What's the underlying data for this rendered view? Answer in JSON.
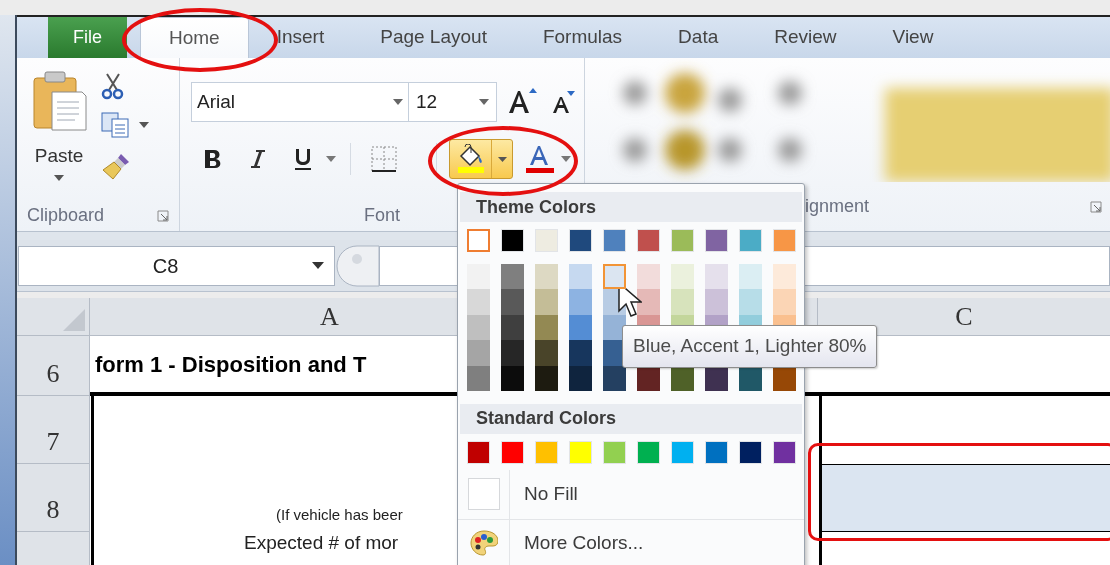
{
  "ribbon": {
    "tabs": [
      {
        "label": "File",
        "kind": "file",
        "selected": false,
        "circled": false
      },
      {
        "label": "Home",
        "kind": "tab",
        "selected": true,
        "circled": true
      },
      {
        "label": "Insert",
        "kind": "tab",
        "selected": false,
        "circled": false
      },
      {
        "label": "Page Layout",
        "kind": "tab",
        "selected": false,
        "circled": false
      },
      {
        "label": "Formulas",
        "kind": "tab",
        "selected": false,
        "circled": false
      },
      {
        "label": "Data",
        "kind": "tab",
        "selected": false,
        "circled": false
      },
      {
        "label": "Review",
        "kind": "tab",
        "selected": false,
        "circled": false
      },
      {
        "label": "View",
        "kind": "tab",
        "selected": false,
        "circled": false
      }
    ],
    "clipboard": {
      "paste_label": "Paste",
      "group_label": "Clipboard"
    },
    "font": {
      "font_name": "Arial",
      "font_size": "12",
      "group_label": "Font",
      "fill_button": {
        "circled": true,
        "pressed": true
      }
    },
    "alignment": {
      "group_label": "ignment"
    }
  },
  "formula_bar": {
    "name_box": "C8"
  },
  "sheet": {
    "columns": [
      {
        "label": "A"
      },
      {
        "label": "C"
      }
    ],
    "rows": [
      {
        "number": "6",
        "a": {
          "text": "form 1 - Disposition and T",
          "kind": "title"
        }
      },
      {
        "number": "7"
      },
      {
        "number": "8",
        "a": {
          "text": "(If vehicle has beer",
          "kind": "note"
        },
        "c": {
          "highlighted": true,
          "circled": true
        }
      },
      {
        "a": {
          "text": "Expected # of mor",
          "kind": "body"
        }
      }
    ]
  },
  "fill_menu": {
    "theme_header": "Theme Colors",
    "theme_columns": [
      {
        "color": "#ffffff",
        "selected": true,
        "shades": [
          {
            "color": "#f2f2f2",
            "hovered": false
          },
          {
            "color": "#d8d8d8",
            "hovered": false
          },
          {
            "color": "#bfbfbf",
            "hovered": false
          },
          {
            "color": "#a5a5a5",
            "hovered": false
          },
          {
            "color": "#7f7f7f",
            "hovered": false
          }
        ]
      },
      {
        "color": "#000000",
        "selected": false,
        "shades": [
          {
            "color": "#7f7f7f",
            "hovered": false
          },
          {
            "color": "#595959",
            "hovered": false
          },
          {
            "color": "#3f3f3f",
            "hovered": false
          },
          {
            "color": "#262626",
            "hovered": false
          },
          {
            "color": "#0c0c0c",
            "hovered": false
          }
        ]
      },
      {
        "color": "#eeece1",
        "selected": false,
        "shades": [
          {
            "color": "#ddd9c3",
            "hovered": false
          },
          {
            "color": "#c4bd97",
            "hovered": false
          },
          {
            "color": "#938953",
            "hovered": false
          },
          {
            "color": "#494429",
            "hovered": false
          },
          {
            "color": "#1d1b10",
            "hovered": false
          }
        ]
      },
      {
        "color": "#1f497d",
        "selected": false,
        "shades": [
          {
            "color": "#c6d9f0",
            "hovered": false
          },
          {
            "color": "#8db3e2",
            "hovered": false
          },
          {
            "color": "#548dd4",
            "hovered": false
          },
          {
            "color": "#17365d",
            "hovered": false
          },
          {
            "color": "#0f243e",
            "hovered": false
          }
        ]
      },
      {
        "color": "#4f81bd",
        "selected": false,
        "shades": [
          {
            "color": "#dbe5f1",
            "hovered": true
          },
          {
            "color": "#b8cce4",
            "hovered": false
          },
          {
            "color": "#95b3d7",
            "hovered": false
          },
          {
            "color": "#366092",
            "hovered": false
          },
          {
            "color": "#244061",
            "hovered": false
          }
        ]
      },
      {
        "color": "#c0504d",
        "selected": false,
        "shades": [
          {
            "color": "#f2dcdb",
            "hovered": false
          },
          {
            "color": "#e5b9b7",
            "hovered": false
          },
          {
            "color": "#d99694",
            "hovered": false
          },
          {
            "color": "#632423",
            "hovered": false
          }
        ]
      },
      {
        "color": "#9bbb59",
        "selected": false,
        "shades": [
          {
            "color": "#ebf1dd",
            "hovered": false
          },
          {
            "color": "#d7e3bc",
            "hovered": false
          },
          {
            "color": "#c3d69b",
            "hovered": false
          },
          {
            "color": "#4f6128",
            "hovered": false
          }
        ]
      },
      {
        "color": "#8064a2",
        "selected": false,
        "shades": [
          {
            "color": "#e5e0ec",
            "hovered": false
          },
          {
            "color": "#ccc1d9",
            "hovered": false
          },
          {
            "color": "#b2a2c7",
            "hovered": false
          },
          {
            "color": "#3f3151",
            "hovered": false
          }
        ]
      },
      {
        "color": "#4bacc6",
        "selected": false,
        "shades": [
          {
            "color": "#dbeef3",
            "hovered": false
          },
          {
            "color": "#b7dde8",
            "hovered": false
          },
          {
            "color": "#92cddc",
            "hovered": false
          },
          {
            "color": "#205867",
            "hovered": false
          }
        ]
      },
      {
        "color": "#f79646",
        "selected": false,
        "shades": [
          {
            "color": "#fdeada",
            "hovered": false
          },
          {
            "color": "#fbd5b5",
            "hovered": false
          },
          {
            "color": "#fac08f",
            "hovered": false
          },
          {
            "color": "#974806",
            "hovered": false
          }
        ]
      }
    ],
    "standard_header": "Standard Colors",
    "standard_colors": [
      {
        "color": "#c00000",
        "selected": false
      },
      {
        "color": "#ff0000",
        "selected": false
      },
      {
        "color": "#ffc000",
        "selected": false
      },
      {
        "color": "#ffff00",
        "selected": false
      },
      {
        "color": "#92d050",
        "selected": false
      },
      {
        "color": "#00b050",
        "selected": false
      },
      {
        "color": "#00b0f0",
        "selected": false
      },
      {
        "color": "#0070c0",
        "selected": false
      },
      {
        "color": "#002060",
        "selected": false
      },
      {
        "color": "#7030a0",
        "selected": false
      }
    ],
    "items": [
      {
        "kind": "no_fill",
        "label": "No Fill"
      },
      {
        "kind": "more_colors",
        "label": "More Colors..."
      }
    ]
  },
  "tooltip": "Blue, Accent 1, Lighter 80%"
}
